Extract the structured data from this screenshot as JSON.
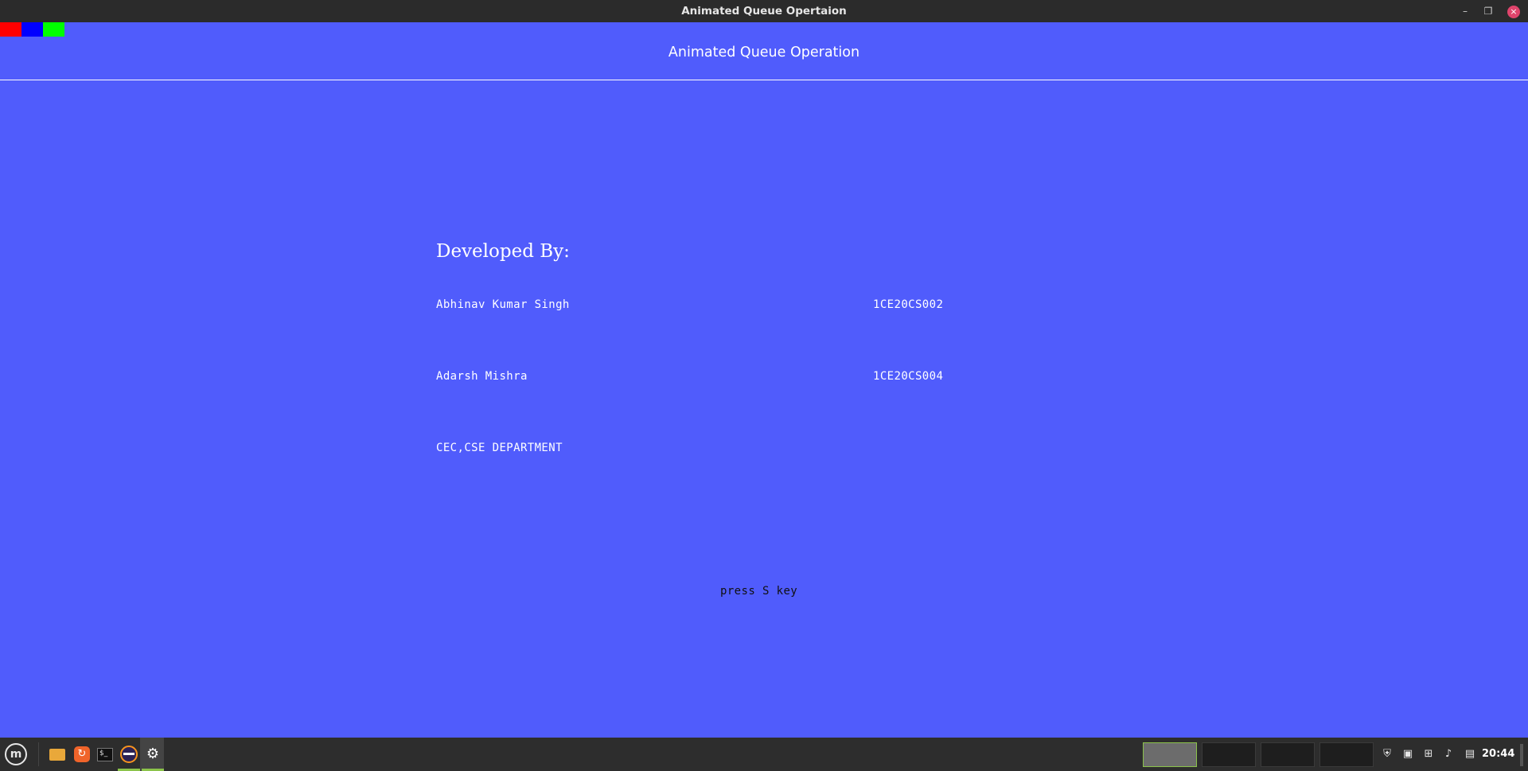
{
  "window": {
    "title": "Animated Queue Opertaion",
    "controls": {
      "minimize": "–",
      "maximize": "❐",
      "close": "×"
    }
  },
  "app": {
    "color_swatches": [
      "#ff0000",
      "#0000ff",
      "#00ff00"
    ],
    "title": "Animated Queue Operation",
    "developed_by": "Developed By:",
    "developers": [
      {
        "name": "Abhinav Kumar Singh",
        "id": "1CE20CS002"
      },
      {
        "name": "Adarsh Mishra",
        "id": "1CE20CS004"
      }
    ],
    "department": "CEC,CSE DEPARTMENT",
    "prompt": "press S key",
    "background_color": "#505cfc"
  },
  "taskbar": {
    "menu_icon": "mint-menu-icon",
    "launchers": [
      "folder-icon",
      "update-manager-icon",
      "terminal-icon",
      "eclipse-icon",
      "settings-gear-icon"
    ],
    "workspaces": 4,
    "active_workspace": 1,
    "tray_icons": [
      "shield-icon",
      "keyboard-layout-icon",
      "network-icon",
      "volume-icon",
      "clipboard-icon"
    ],
    "clock": "20:44"
  }
}
